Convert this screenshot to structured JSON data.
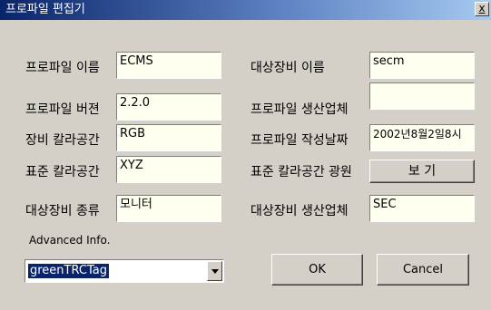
{
  "window": {
    "title": "프로파일 편집기",
    "close_label": "x"
  },
  "left_fields": [
    {
      "label": "프로파일 이름",
      "value": "ECMS"
    },
    {
      "label": "프로파일 버젼",
      "value": "2.2.0"
    },
    {
      "label": "장비 칼라공간",
      "value": "RGB"
    },
    {
      "label": "표준 칼라공간",
      "value": "XYZ"
    },
    {
      "label": "대상장비 종류",
      "value": "모니터"
    }
  ],
  "right_fields": [
    {
      "label": "대상장비 이름",
      "value": "secm"
    },
    {
      "label": "프로파일 생산업체",
      "value": ""
    },
    {
      "label": "프로파일 작성날짜",
      "value": "2002년8월2일8시"
    },
    {
      "label": "표준 칼라공간 광원",
      "button": "보 기"
    },
    {
      "label": "대상장비 생산업체",
      "value": "SEC"
    }
  ],
  "advanced": {
    "label": "Advanced Info.",
    "selected": "greenTRCTag"
  },
  "buttons": {
    "ok": "OK",
    "cancel": "Cancel"
  },
  "colors": {
    "title_start": "#0a246a",
    "title_end": "#a6caf0",
    "face": "#d4d0c8",
    "field_bg": "#fffff0"
  }
}
